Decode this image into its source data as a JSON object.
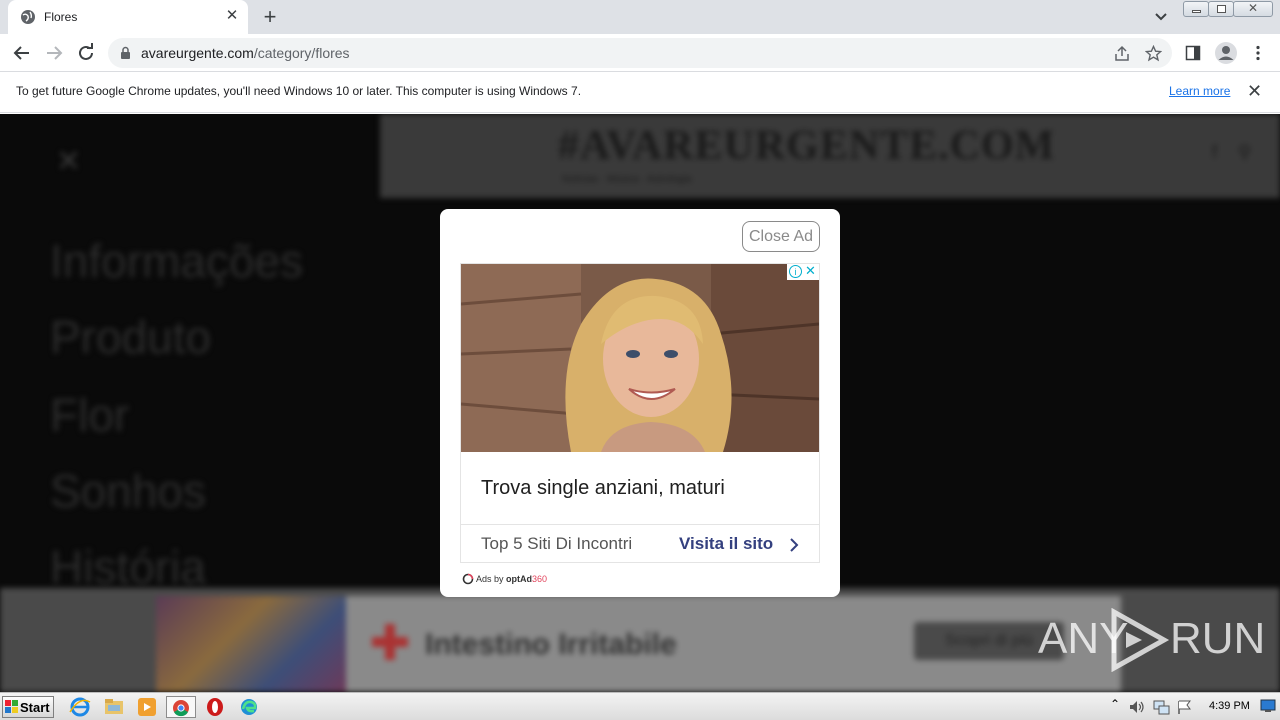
{
  "browser": {
    "tab_title": "Flores",
    "url_host": "avareurgente.com",
    "url_path": "/category/flores",
    "infobar_message": "To get future Google Chrome updates, you'll need Windows 10 or later. This computer is using Windows 7.",
    "infobar_link": "Learn more"
  },
  "site": {
    "logo": "#AVAREURGENTE.COM",
    "tagline": "Notícias · Música · Astrologia",
    "menu": [
      "Informações",
      "Produto",
      "Flor",
      "Sonhos",
      "História"
    ]
  },
  "background_ad": {
    "title": "Intestino Irritabile",
    "button": "Scopri di più"
  },
  "modal_ad": {
    "close_label": "Close Ad",
    "headline": "Trova single anziani, maturi",
    "source": "Top 5 Siti Di Incontri",
    "cta": "Visita il sito",
    "ads_by": "Ads by ",
    "ads_brand": "optAd",
    "ads_num": "360"
  },
  "watermark": {
    "part1": "ANY",
    "part2": "RUN"
  },
  "taskbar": {
    "start_label": "Start",
    "clock": "4:39 PM"
  },
  "colors": {
    "cta": "#34407f",
    "link": "#1a73e8",
    "page_bg": "#0a0a0a"
  }
}
